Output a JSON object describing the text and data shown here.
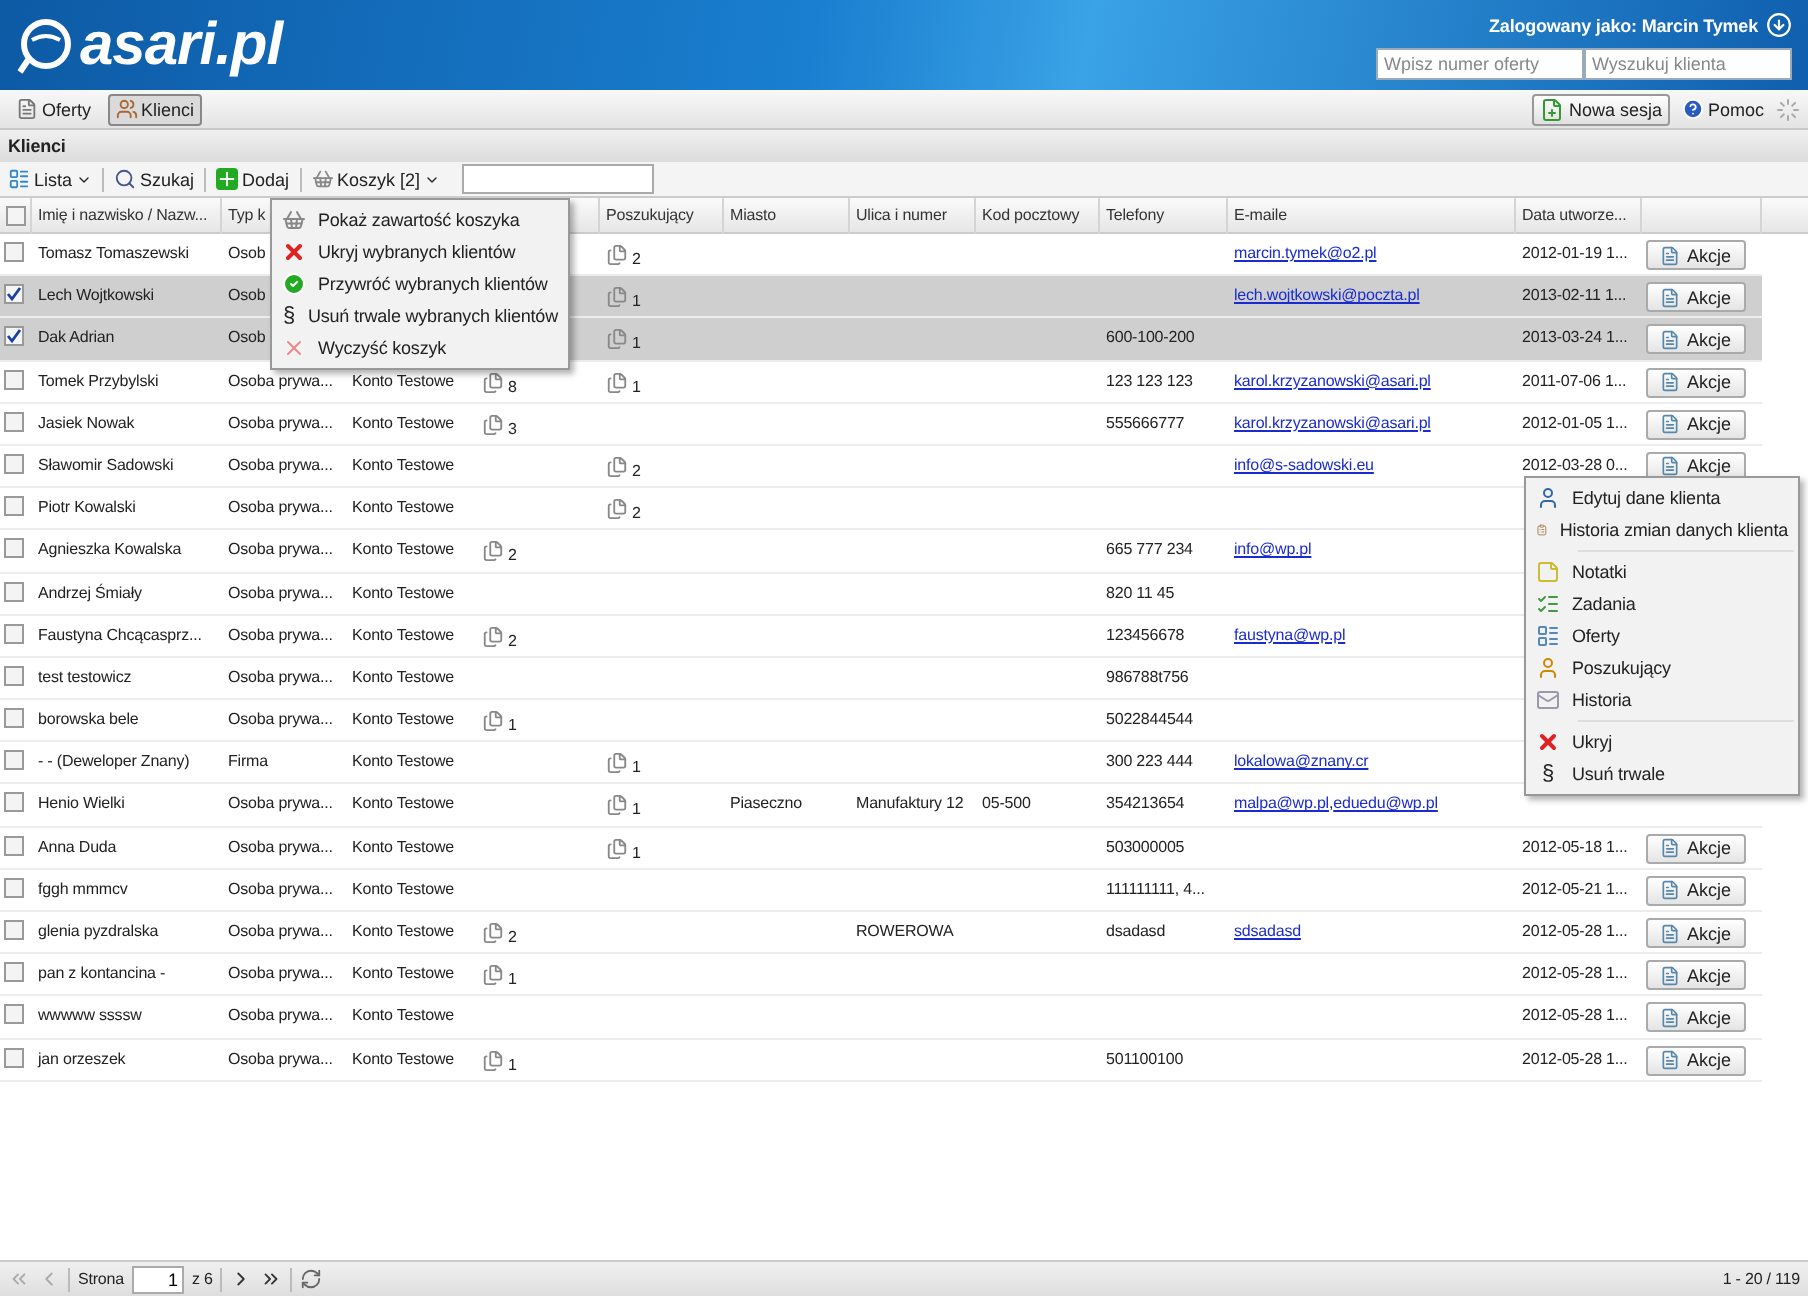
{
  "header": {
    "logo": "asari.pl",
    "user": "Zalogowany jako: Marcin Tymek",
    "search_offer": {
      "placeholder": "Wpisz numer oferty"
    },
    "search_client": {
      "placeholder": "Wyszukuj klienta"
    }
  },
  "tabs": [
    {
      "label": "Oferty",
      "selected": false
    },
    {
      "label": "Klienci",
      "selected": true
    }
  ],
  "right_tools": {
    "new_session": "Nowa sesja",
    "help": "Pomoc"
  },
  "section_title": "Klienci",
  "toolbar": {
    "list": "Lista",
    "search": "Szukaj",
    "add": "Dodaj",
    "basket": "Koszyk [2]"
  },
  "table": {
    "select_all": {
      "checked": false
    },
    "columns": [
      "Imię i nazwisko / Nazw...",
      "Typ k",
      "",
      "",
      "Poszukujący",
      "Miasto",
      "Ulica i numer",
      "Kod pocztowy",
      "Telefony",
      "E-maile",
      "Data utworze..."
    ],
    "rows": [
      {
        "checked": false,
        "name": "Tomasz Tomaszewski",
        "type": "Osob",
        "seekers": "2",
        "emails": [
          "marcin.tymek@o2.pl"
        ],
        "created": "2012-01-19 1...",
        "action": "Akcje"
      },
      {
        "checked": true,
        "name": "Lech Wojtkowski",
        "type": "Osob",
        "seekers": "1",
        "emails": [
          "lech.wojtkowski@poczta.pl"
        ],
        "created": "2013-02-11 1...",
        "action": "Akcje"
      },
      {
        "checked": true,
        "name": "Dak Adrian",
        "type": "Osob",
        "seekers": "1",
        "phones": "600-100-200",
        "created": "2013-03-24 1...",
        "action": "Akcje"
      },
      {
        "checked": false,
        "name": "Tomek Przybylski",
        "type": "Osoba prywa...",
        "account": "Konto Testowe",
        "offers": "8",
        "seekers": "1",
        "phones": "123 123 123",
        "emails": [
          "karol.krzyzanowski@asari.pl"
        ],
        "created": "2011-07-06 1...",
        "action": "Akcje"
      },
      {
        "checked": false,
        "name": "Jasiek Nowak",
        "type": "Osoba prywa...",
        "account": "Konto Testowe",
        "offers": "3",
        "phones": "555666777",
        "emails": [
          "karol.krzyzanowski@asari.pl"
        ],
        "created": "2012-01-05 1...",
        "action": "Akcje"
      },
      {
        "checked": false,
        "name": "Sławomir Sadowski",
        "type": "Osoba prywa...",
        "account": "Konto Testowe",
        "seekers": "2",
        "emails": [
          "info@s-sadowski.eu"
        ],
        "created": "2012-03-28 0...",
        "action": "Akcje"
      },
      {
        "checked": false,
        "name": "Piotr Kowalski",
        "type": "Osoba prywa...",
        "account": "Konto Testowe",
        "seekers": "2"
      },
      {
        "checked": false,
        "name": "Agnieszka Kowalska",
        "type": "Osoba prywa...",
        "account": "Konto Testowe",
        "offers": "2",
        "phones": "665 777 234",
        "emails": [
          "info@wp.pl"
        ]
      },
      {
        "checked": false,
        "name": "Andrzej Śmiały",
        "type": "Osoba prywa...",
        "account": "Konto Testowe",
        "phones": "820 11 45"
      },
      {
        "checked": false,
        "name": "Faustyna Chcącasprz...",
        "type": "Osoba prywa...",
        "account": "Konto Testowe",
        "offers": "2",
        "phones": "123456678",
        "emails": [
          "faustyna@wp.pl"
        ]
      },
      {
        "checked": false,
        "name": "test testowicz",
        "type": "Osoba prywa...",
        "account": "Konto Testowe",
        "phones": "986788t756"
      },
      {
        "checked": false,
        "name": "borowska bele",
        "type": "Osoba prywa...",
        "account": "Konto Testowe",
        "offers": "1",
        "phones": "5022844544"
      },
      {
        "checked": false,
        "name": "- - (Deweloper Znany)",
        "type": "Firma",
        "account": "Konto Testowe",
        "seekers": "1",
        "phones": "300 223 444",
        "emails": [
          "lokalowa@znany.cr"
        ]
      },
      {
        "checked": false,
        "name": "Henio Wielki",
        "type": "Osoba prywa...",
        "account": "Konto Testowe",
        "seekers": "1",
        "city": "Piaseczno",
        "street": "Manufaktury 12",
        "zip": "05-500",
        "phones": "354213654",
        "emails": [
          "malpa@wp.pl",
          "eduedu@wp.pl"
        ],
        "email_separator": ","
      },
      {
        "checked": false,
        "name": "Anna Duda",
        "type": "Osoba prywa...",
        "account": "Konto Testowe",
        "seekers": "1",
        "phones": "503000005",
        "created": "2012-05-18 1...",
        "action": "Akcje"
      },
      {
        "checked": false,
        "name": "fggh mmmcv",
        "type": "Osoba prywa...",
        "account": "Konto Testowe",
        "phones": "111111111, 4...",
        "created": "2012-05-21 1...",
        "action": "Akcje"
      },
      {
        "checked": false,
        "name": "glenia pyzdralska",
        "type": "Osoba prywa...",
        "account": "Konto Testowe",
        "offers": "2",
        "street": "ROWEROWA",
        "phones": "dsadasd",
        "emails": [
          "sdsadasd"
        ],
        "created": "2012-05-28 1...",
        "action": "Akcje"
      },
      {
        "checked": false,
        "name": "pan z kontancina -",
        "type": "Osoba prywa...",
        "account": "Konto Testowe",
        "offers": "1",
        "created": "2012-05-28 1...",
        "action": "Akcje"
      },
      {
        "checked": false,
        "name": "wwwww ssssw",
        "type": "Osoba prywa...",
        "account": "Konto Testowe",
        "created": "2012-05-28 1...",
        "action": "Akcje"
      },
      {
        "checked": false,
        "name": "jan orzeszek",
        "type": "Osoba prywa...",
        "account": "Konto Testowe",
        "offers": "1",
        "phones": "501100100",
        "created": "2012-05-28 1...",
        "action": "Akcje"
      }
    ]
  },
  "basket_menu": [
    {
      "kind": "show",
      "label": "Pokaż zawartość koszyka"
    },
    {
      "kind": "hide",
      "label": "Ukryj wybranych klientów"
    },
    {
      "kind": "restore",
      "label": "Przywróć wybranych klientów"
    },
    {
      "kind": "glyph",
      "glyph": "§",
      "label": "Usuń trwale wybranych klientów"
    },
    {
      "kind": "clear",
      "label": "Wyczyść koszyk"
    }
  ],
  "context_menu": [
    [
      {
        "kind": "edit",
        "label": "Edytuj dane klienta"
      },
      {
        "kind": "history",
        "label": "Historia zmian danych klienta"
      }
    ],
    [
      {
        "kind": "notes",
        "label": "Notatki"
      },
      {
        "kind": "tasks",
        "label": "Zadania"
      },
      {
        "kind": "offers",
        "label": "Oferty"
      },
      {
        "kind": "seekers",
        "label": "Poszukujący"
      },
      {
        "kind": "mail",
        "label": "Historia"
      }
    ],
    [
      {
        "kind": "hide",
        "label": "Ukryj"
      },
      {
        "kind": "glyph",
        "glyph": "§",
        "label": "Usuń trwale"
      }
    ]
  ],
  "pager": {
    "page_label": "Strona",
    "page": "1",
    "of": "z 6",
    "summary": "1 - 20 / 119"
  }
}
